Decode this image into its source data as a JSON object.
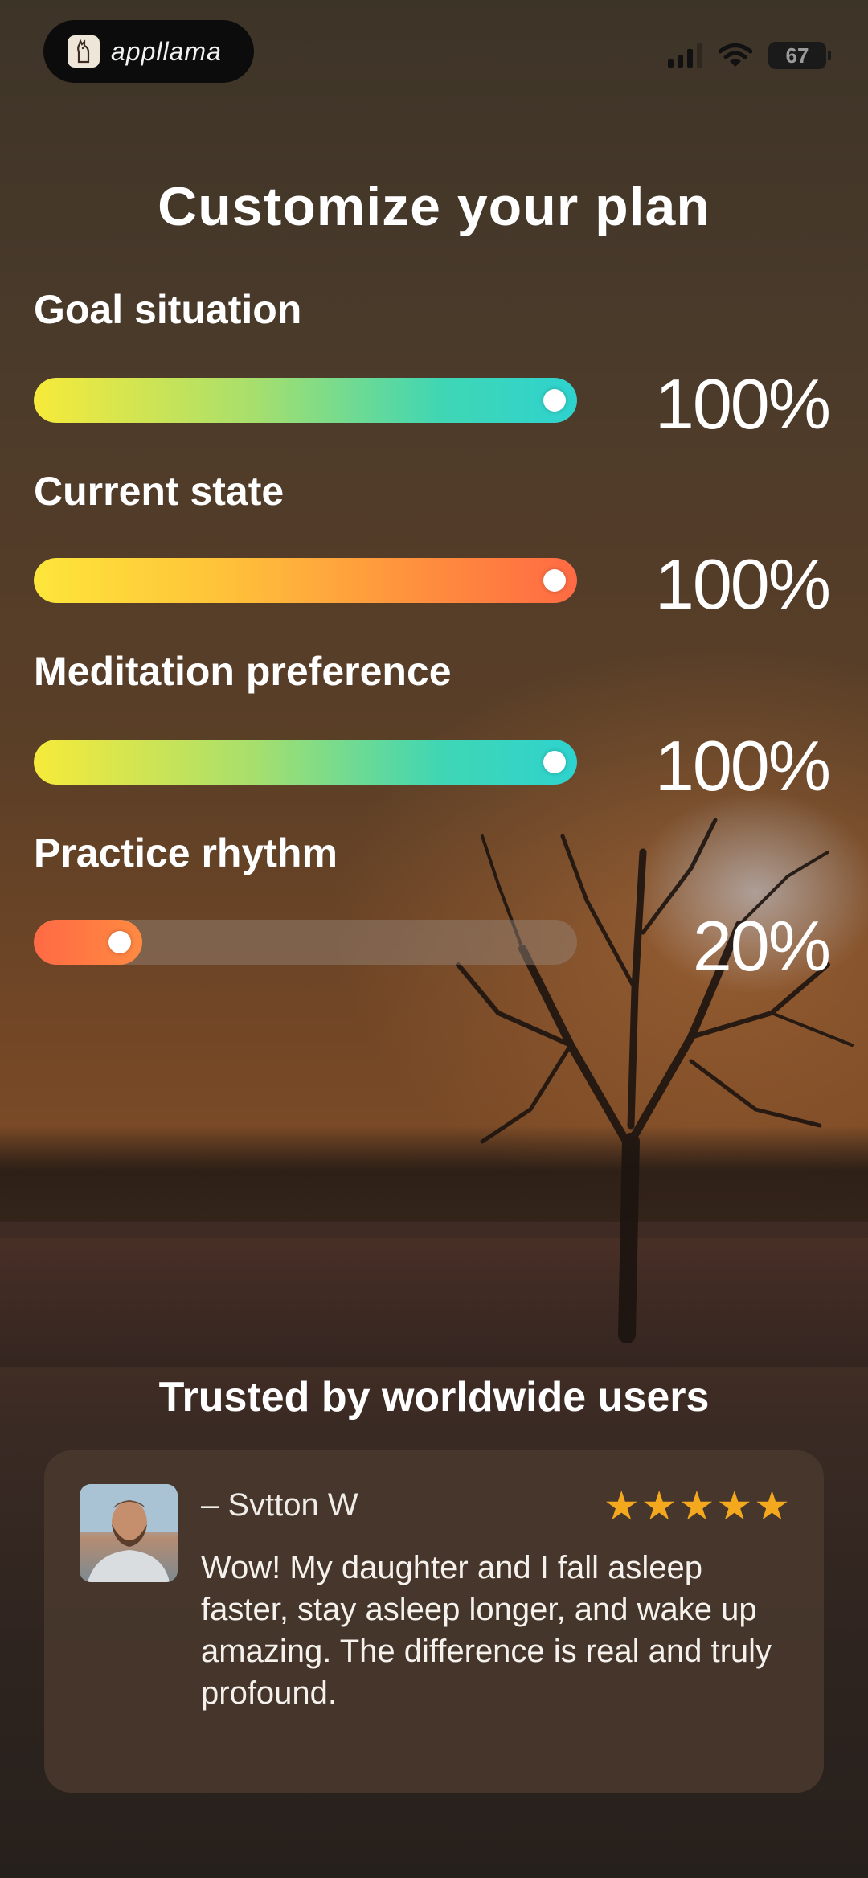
{
  "status_bar": {
    "app_name": "appllama",
    "battery": "67",
    "logo_icon": "llama-icon",
    "signal_icon": "cellular-signal-icon",
    "wifi_icon": "wifi-icon"
  },
  "page": {
    "title": "Customize your plan"
  },
  "plan": {
    "rows": [
      {
        "label": "Goal situation",
        "percent_text": "100%",
        "value": 100,
        "style": "green"
      },
      {
        "label": "Current state",
        "percent_text": "100%",
        "value": 100,
        "style": "orange"
      },
      {
        "label": "Meditation preference",
        "percent_text": "100%",
        "value": 100,
        "style": "green"
      },
      {
        "label": "Practice rhythm",
        "percent_text": "20%",
        "value": 20,
        "style": "red"
      }
    ]
  },
  "social_proof": {
    "heading": "Trusted by worldwide users",
    "review": {
      "name": "– Svtton W",
      "stars": "★★★★★",
      "rating": 5,
      "text": "Wow! My daughter and I fall asleep faster, stay asleep longer, and wake up amazing. The difference is real and truly profound."
    }
  },
  "colors": {
    "star": "#f3a81e",
    "green_end": "#2ed3cf",
    "orange_end": "#ff6a44",
    "card_bg": "#48372c"
  }
}
